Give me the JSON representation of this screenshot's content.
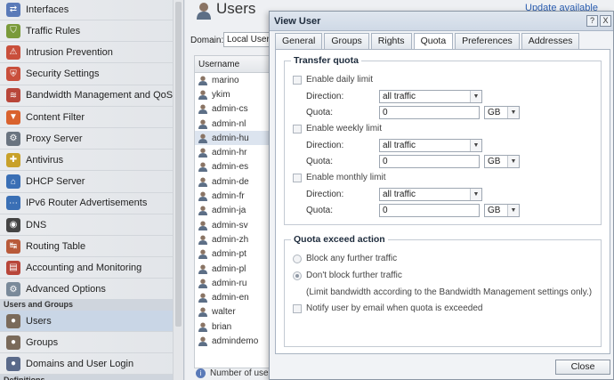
{
  "sidebar": {
    "items": [
      {
        "label": "Interfaces",
        "icon": "interfaces-icon",
        "color": "#5a7ab8"
      },
      {
        "label": "Traffic Rules",
        "icon": "traffic-rules-icon",
        "color": "#7a9a3a"
      },
      {
        "label": "Intrusion Prevention",
        "icon": "intrusion-prevention-icon",
        "color": "#c94f3c"
      },
      {
        "label": "Security Settings",
        "icon": "security-settings-icon",
        "color": "#c94f3c"
      },
      {
        "label": "Bandwidth Management and QoS",
        "icon": "bandwidth-icon",
        "color": "#b8463a"
      },
      {
        "label": "Content Filter",
        "icon": "content-filter-icon",
        "color": "#d9622e"
      },
      {
        "label": "Proxy Server",
        "icon": "proxy-server-icon",
        "color": "#6a7480"
      },
      {
        "label": "Antivirus",
        "icon": "antivirus-icon",
        "color": "#c8a12a"
      },
      {
        "label": "DHCP Server",
        "icon": "dhcp-server-icon",
        "color": "#3a6fb5"
      },
      {
        "label": "IPv6 Router Advertisements",
        "icon": "ipv6-icon",
        "color": "#3a6fb5"
      },
      {
        "label": "DNS",
        "icon": "dns-icon",
        "color": "#444444"
      },
      {
        "label": "Routing Table",
        "icon": "routing-table-icon",
        "color": "#b85a3a"
      },
      {
        "label": "Accounting and Monitoring",
        "icon": "accounting-icon",
        "color": "#b8463a"
      },
      {
        "label": "Advanced Options",
        "icon": "advanced-options-icon",
        "color": "#7a8a9a"
      }
    ],
    "section_label": "Users and Groups",
    "section_items": [
      {
        "label": "Users",
        "icon": "users-icon",
        "color": "#7a6a5a"
      },
      {
        "label": "Groups",
        "icon": "groups-icon",
        "color": "#7a6a5a"
      },
      {
        "label": "Domains and User Login",
        "icon": "domains-icon",
        "color": "#5a6a8a"
      }
    ],
    "footer_section_label": "Definitions"
  },
  "main": {
    "title": "Users",
    "update_link": "Update available",
    "domain_label": "Domain:",
    "domain_value": "Local User Da",
    "list_header": "Username",
    "users": [
      "marino",
      "ykim",
      "admin-cs",
      "admin-nl",
      "admin-hu",
      "admin-hr",
      "admin-es",
      "admin-de",
      "admin-fr",
      "admin-ja",
      "admin-sv",
      "admin-zh",
      "admin-pt",
      "admin-pl",
      "admin-ru",
      "admin-en",
      "walter",
      "brian",
      "admindemo"
    ],
    "selected_user": "admin-hu",
    "users_count": "Number of users i"
  },
  "dialog": {
    "title": "View User",
    "help_glyph": "?",
    "close_glyph": "X",
    "tabs": [
      "General",
      "Groups",
      "Rights",
      "Quota",
      "Preferences",
      "Addresses"
    ],
    "active_tab": "Quota",
    "transfer_quota": {
      "legend": "Transfer quota",
      "daily": {
        "label": "Enable daily limit",
        "direction_label": "Direction:",
        "direction": "all traffic",
        "quota_label": "Quota:",
        "quota": "0",
        "unit": "GB"
      },
      "weekly": {
        "label": "Enable weekly limit",
        "direction_label": "Direction:",
        "direction": "all traffic",
        "quota_label": "Quota:",
        "quota": "0",
        "unit": "GB"
      },
      "monthly": {
        "label": "Enable monthly limit",
        "direction_label": "Direction:",
        "direction": "all traffic",
        "quota_label": "Quota:",
        "quota": "0",
        "unit": "GB"
      }
    },
    "exceed_action": {
      "legend": "Quota exceed action",
      "option_block": "Block any further traffic",
      "option_dont_block": "Don't block further traffic",
      "selected": "dont_block",
      "note": "(Limit bandwidth according to the Bandwidth Management settings only.)",
      "notify_label": "Notify user by email when quota is exceeded"
    },
    "close_label": "Close"
  }
}
